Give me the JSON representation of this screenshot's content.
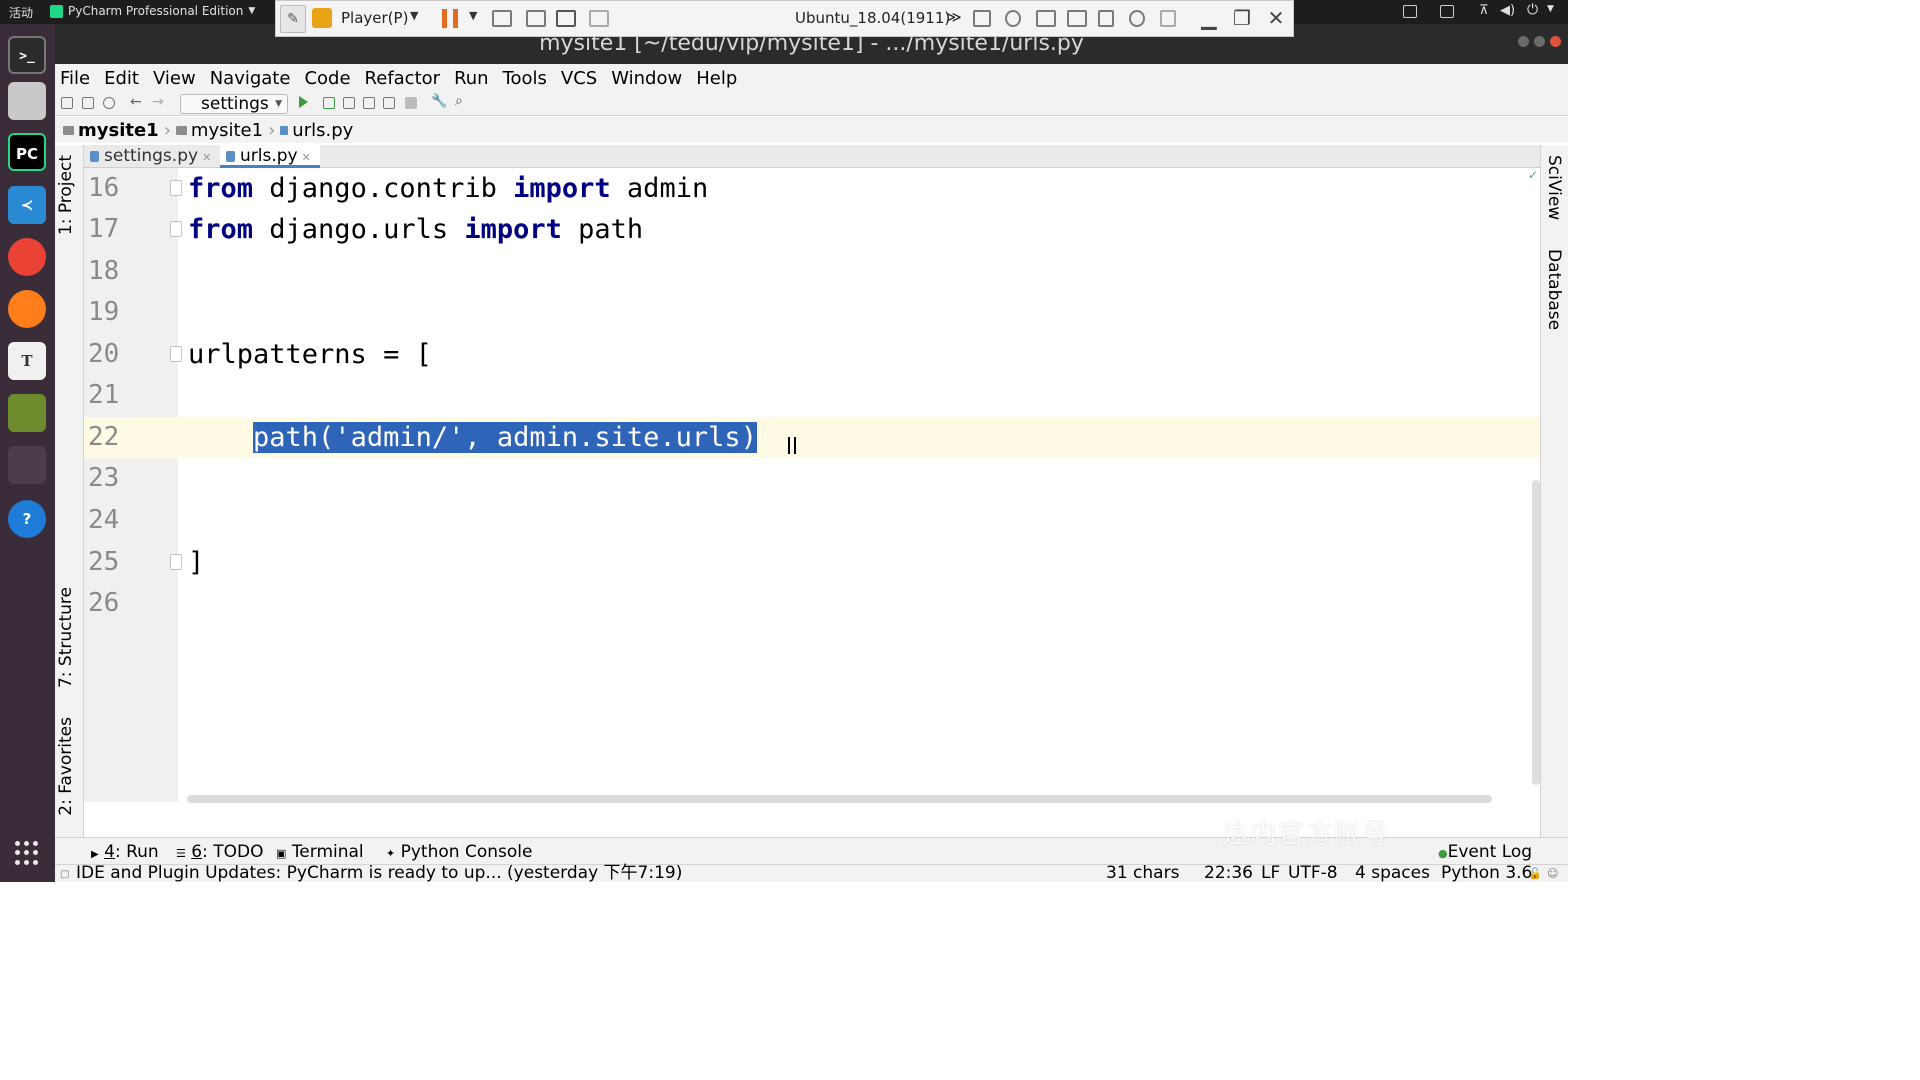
{
  "system_bar": {
    "activities": "活动",
    "app_menu": "PyCharm Professional Edition"
  },
  "vm_toolbar": {
    "player_label": "Player(P)",
    "vm_name": "Ubuntu_18.04(1911)",
    "more": "≫"
  },
  "window": {
    "title": "mysite1 [~/tedu/vip/mysite1] - .../mysite1/urls.py"
  },
  "menu": [
    "File",
    "Edit",
    "View",
    "Navigate",
    "Code",
    "Refactor",
    "Run",
    "Tools",
    "VCS",
    "Window",
    "Help"
  ],
  "run_config": "settings",
  "breadcrumb": [
    "mysite1",
    "mysite1",
    "urls.py"
  ],
  "tabs": [
    {
      "label": "settings.py",
      "active": false
    },
    {
      "label": "urls.py",
      "active": true
    }
  ],
  "left_tools": {
    "project": "1: Project",
    "structure": "7: Structure",
    "favorites": "2: Favorites"
  },
  "right_tools": {
    "sciview": "SciView",
    "database": "Database"
  },
  "editor": {
    "lines": [
      {
        "n": "16",
        "kw1": "from",
        "t1": " django.contrib ",
        "kw2": "import",
        "t2": " admin"
      },
      {
        "n": "17",
        "kw1": "from",
        "t1": " django.urls ",
        "kw2": "import",
        "t2": " path"
      },
      {
        "n": "18"
      },
      {
        "n": "19"
      },
      {
        "n": "20",
        "text": "urlpatterns = ["
      },
      {
        "n": "21"
      },
      {
        "n": "22",
        "indent": "    ",
        "selected": "path('admin/', admin.site.urls)"
      },
      {
        "n": "23"
      },
      {
        "n": "24"
      },
      {
        "n": "25",
        "text": "]"
      },
      {
        "n": "26"
      }
    ]
  },
  "tool_windows": [
    {
      "key": "4",
      "label": ": Run"
    },
    {
      "key": "6",
      "label": ": TODO"
    },
    {
      "key": "",
      "label": "Terminal"
    },
    {
      "key": "",
      "label": "Python Console"
    }
  ],
  "event_log": "Event Log",
  "status": {
    "message": "IDE and Plugin Updates: PyCharm is ready to up... (yesterday 下午7:19)",
    "chars": "31 chars",
    "position": "22:36",
    "line_sep": "LF",
    "encoding": "UTF-8",
    "indent": "4 spaces",
    "interpreter": "Python 3.6"
  },
  "watermark": "达内官方账号",
  "colors": {
    "keyword": "#000080",
    "selection": "#2f65b8",
    "caret_line": "#fffae3",
    "dock_bg": "#3a2c38"
  }
}
